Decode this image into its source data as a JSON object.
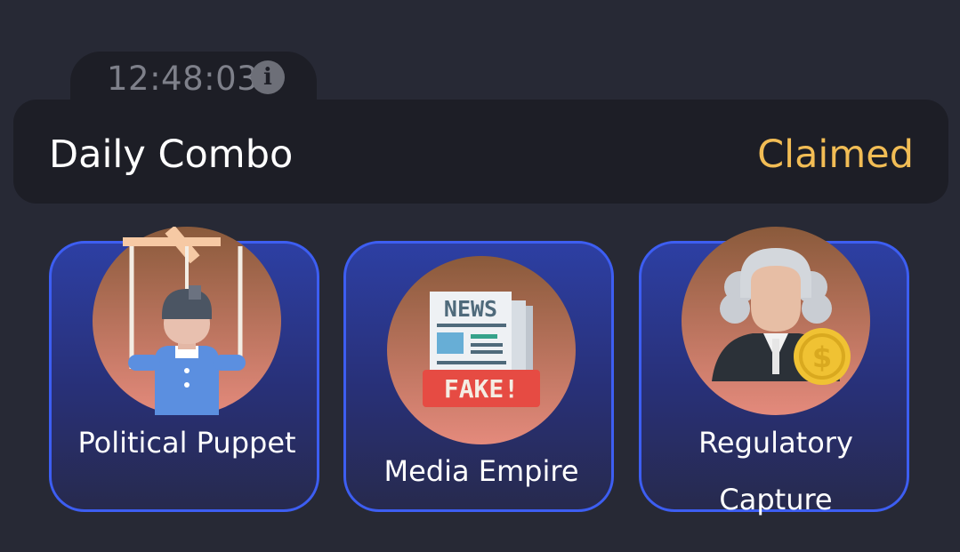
{
  "timer": {
    "time": "12:48:03",
    "info_icon": "info-icon",
    "info_glyph": "i"
  },
  "daily_combo": {
    "title": "Daily Combo",
    "status": "Claimed",
    "status_color": "#f2bd55"
  },
  "cards": [
    {
      "label": "Political Puppet",
      "icon": "marionette-puppet-icon"
    },
    {
      "label": "Media Empire",
      "icon": "fake-news-newspaper-icon",
      "icon_text_top": "NEWS",
      "icon_text_badge": "FAKE!"
    },
    {
      "label": "Regulatory Capture",
      "icon": "judge-with-coin-icon",
      "coin_symbol": "$"
    }
  ],
  "colors": {
    "background": "#272935",
    "panel": "#1d1e26",
    "card_border": "#3d5ef2",
    "accent": "#f2bd55"
  }
}
